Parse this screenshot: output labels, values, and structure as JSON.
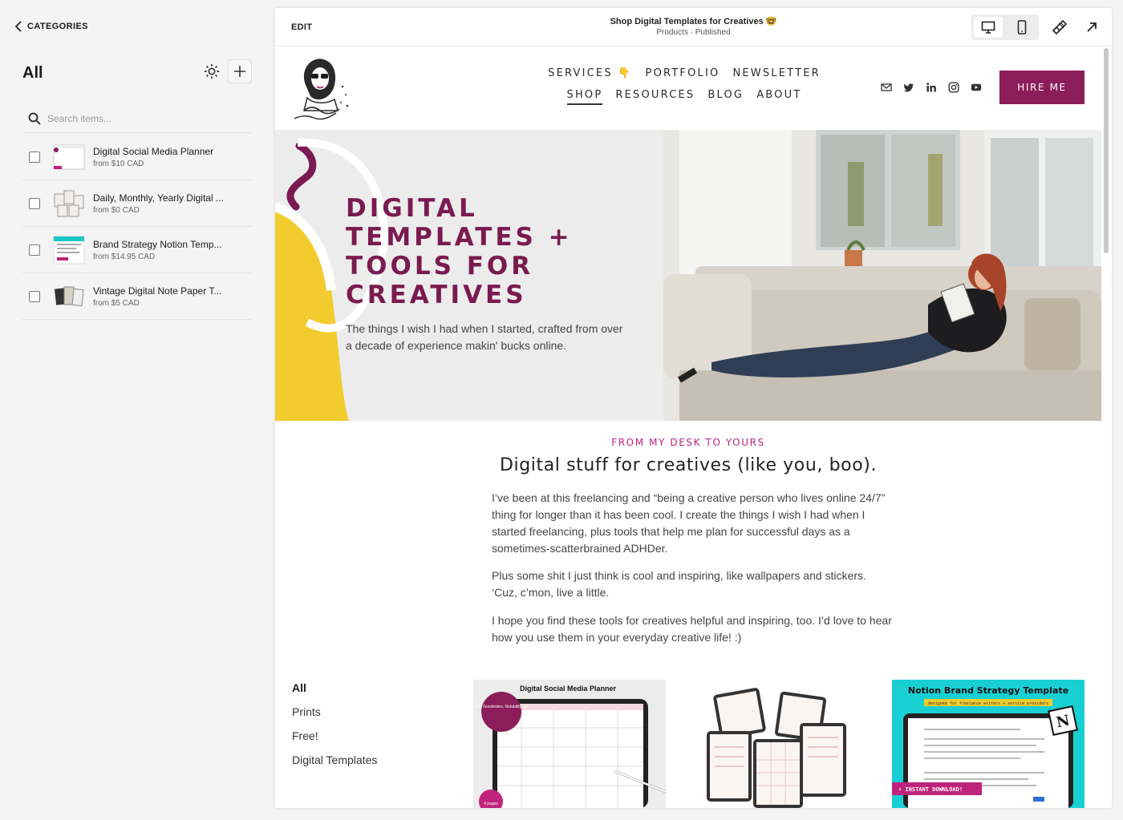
{
  "sidebar": {
    "back_label": "CATEGORIES",
    "title": "All",
    "search_placeholder": "Search items...",
    "items": [
      {
        "name": "Digital Social Media Planner",
        "price": "from $10 CAD"
      },
      {
        "name": "Daily, Monthly, Yearly Digital ...",
        "price": "from $0 CAD"
      },
      {
        "name": "Brand Strategy Notion Temp...",
        "price": "from $14.95 CAD"
      },
      {
        "name": "Vintage Digital Note Paper T...",
        "price": "from $5 CAD"
      }
    ]
  },
  "topbar": {
    "edit_label": "EDIT",
    "page_title": "Shop Digital Templates for Creatives 🤓",
    "page_subtitle": "Products · Published"
  },
  "site": {
    "nav_row1": [
      "SERVICES 👇",
      "PORTFOLIO",
      "NEWSLETTER"
    ],
    "nav_row2": [
      "SHOP",
      "RESOURCES",
      "BLOG",
      "ABOUT"
    ],
    "hire_label": "HIRE ME",
    "accent": "#8c1d5b",
    "hero": {
      "heading": "DIGITAL TEMPLATES + TOOLS FOR CREATIVES",
      "subtext": "The things I wish I had when I started, crafted from over a decade of experience makin' bucks online."
    },
    "eyebrow": "FROM MY DESK TO YOURS",
    "section_heading": "Digital stuff for creatives (like you, boo).",
    "paragraphs": [
      "I’ve been at this freelancing and “being a creative person who lives online 24/7” thing for longer than it has been cool. I create the things I wish I had when I started freelancing, plus tools that help me plan for successful days as a sometimes-scatterbrained ADHDer.",
      "Plus some shit I just think is cool and inspiring, like wallpapers and stickers. ‘Cuz, c’mon, live a little.",
      "I hope you find these tools for creatives helpful and inspiring, too. I’d love to hear how you use them in your everyday creative life! :)"
    ],
    "filters": [
      "All",
      "Prints",
      "Free!",
      "Digital Templates"
    ],
    "products": {
      "p1_title": "Digital Social Media Planner",
      "p1_badge": "PDF Goodnotes, Notability, etc",
      "p1_pages": "4 pages",
      "p3_title": "Notion Brand Strategy Template",
      "p3_sub": "designed for freelance writers + service providers",
      "p3_download": "⬇ INSTANT DOWNLOAD!"
    }
  }
}
